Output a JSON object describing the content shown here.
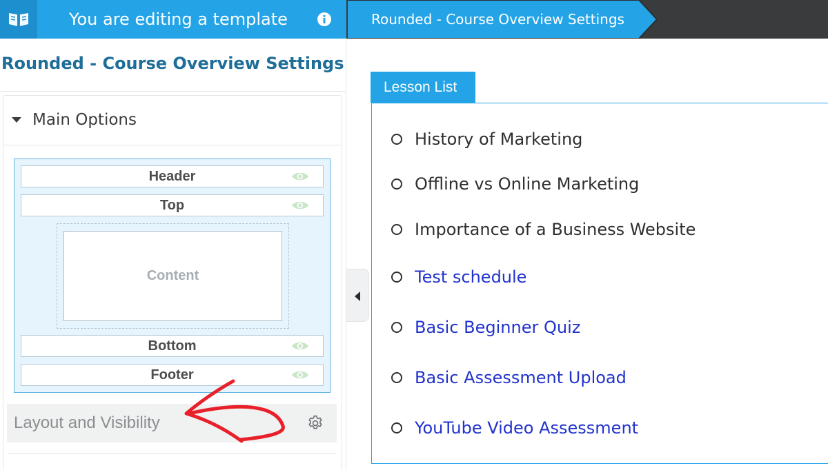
{
  "topbar": {
    "template_title": "You are editing a template",
    "breadcrumb": "Rounded - Course Overview Settings",
    "icons": {
      "logo": "open-book-icon",
      "info": "info-icon"
    }
  },
  "panel": {
    "title": "Rounded - Course Overview Settings",
    "main_options": "Main Options",
    "regions": {
      "header": "Header",
      "top": "Top",
      "content": "Content",
      "bottom": "Bottom",
      "footer": "Footer"
    },
    "layout_visibility": "Layout and Visibility"
  },
  "preview": {
    "tab_label": "Lesson List",
    "lessons": [
      {
        "title": "History of Marketing",
        "link": false
      },
      {
        "title": "Offline vs Online Marketing",
        "link": false
      },
      {
        "title": "Importance of a Business Website",
        "link": false
      },
      {
        "title": "Test schedule",
        "link": true
      },
      {
        "title": "Basic Beginner Quiz",
        "link": true
      },
      {
        "title": "Basic Assessment Upload",
        "link": true
      },
      {
        "title": "YouTube Video Assessment",
        "link": true
      }
    ]
  },
  "colors": {
    "brand_blue": "#24a4e6",
    "dark_bar": "#3a3b3d",
    "title_blue": "#1e6e99",
    "link_blue": "#2233cc",
    "annotation_red": "#e8202a"
  }
}
